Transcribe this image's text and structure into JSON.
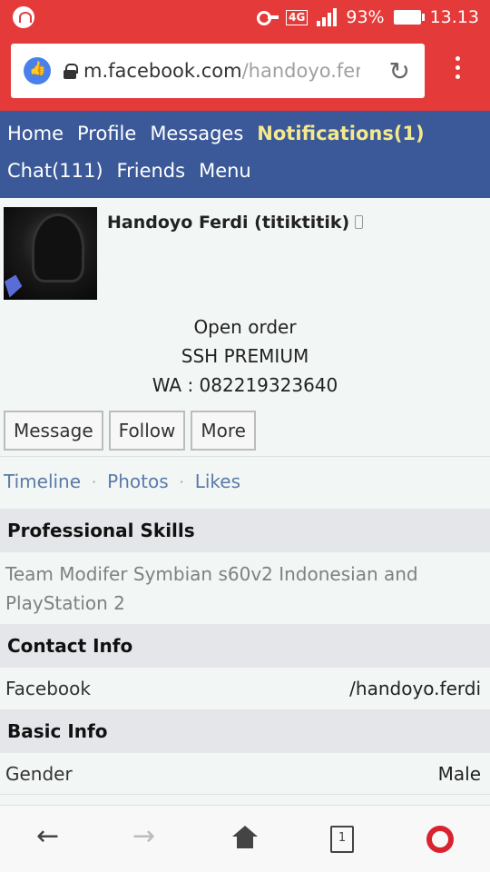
{
  "status_bar": {
    "network": "4G",
    "battery": "93%",
    "time": "13.13"
  },
  "browser": {
    "url_host": "m.facebook.com",
    "url_path": "/handoyo.ferdi"
  },
  "fb_nav": {
    "items_row1": [
      "Home",
      "Profile",
      "Messages"
    ],
    "notifications": "Notifications(1)",
    "items_row2": [
      "Chat(111)",
      "Friends",
      "Menu"
    ]
  },
  "profile": {
    "name": "Handoyo Ferdi (titiktitik)",
    "bio_lines": [
      "Open order",
      "SSH PREMIUM",
      "WA : 082219323640"
    ],
    "buttons": [
      "Message",
      "Follow",
      "More"
    ],
    "tabs": [
      "Timeline",
      "Photos",
      "Likes"
    ]
  },
  "sections": {
    "professional_skills": {
      "title": "Professional Skills",
      "text": "Team Modifer Symbian s60v2 Indonesian and PlayStation 2"
    },
    "contact_info": {
      "title": "Contact Info",
      "key": "Facebook",
      "value": "/handoyo.ferdi"
    },
    "basic_info": {
      "title": "Basic Info",
      "key": "Gender",
      "value": "Male"
    }
  },
  "icons": {
    "status": [
      "notification-icon",
      "key-icon",
      "signal-icon",
      "battery-icon"
    ],
    "browser": [
      "facebook-like-icon",
      "lock-icon",
      "reload-icon",
      "menu-kebab-icon"
    ],
    "bottom": [
      "back-arrow-icon",
      "forward-arrow-icon",
      "home-icon",
      "tabs-icon",
      "opera-icon"
    ]
  },
  "colors": {
    "status_red": "#e53a3a",
    "fb_blue": "#3b5998",
    "notif_yellow": "#f5e98c",
    "link_blue": "#5b7aa8"
  }
}
